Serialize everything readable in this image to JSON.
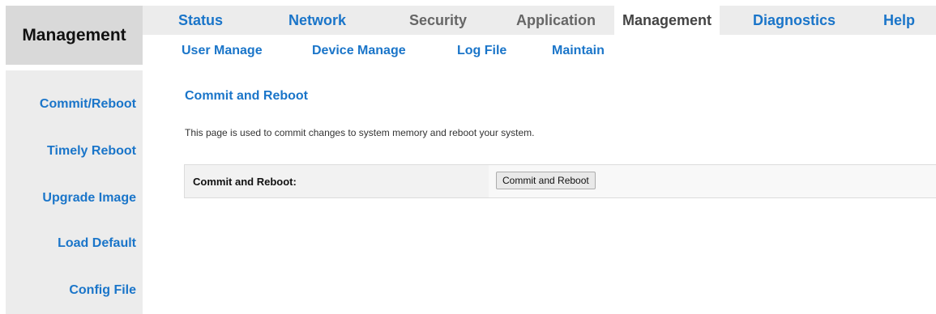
{
  "brand": {
    "title": "Management"
  },
  "top_nav": [
    {
      "label": "Status"
    },
    {
      "label": "Network"
    },
    {
      "label": "Security"
    },
    {
      "label": "Application"
    },
    {
      "label": "Management"
    },
    {
      "label": "Diagnostics"
    },
    {
      "label": "Help"
    }
  ],
  "top_nav_active": "Management",
  "sub_nav": [
    {
      "label": "User Manage"
    },
    {
      "label": "Device Manage"
    },
    {
      "label": "Log File"
    },
    {
      "label": "Maintain"
    }
  ],
  "sidebar": {
    "items": [
      {
        "label": "Commit/Reboot"
      },
      {
        "label": "Timely Reboot"
      },
      {
        "label": "Upgrade Image"
      },
      {
        "label": "Load Default"
      },
      {
        "label": "Config File"
      }
    ]
  },
  "content": {
    "title": "Commit and Reboot",
    "description": "This page is used to commit changes to system memory and reboot your system.",
    "form": {
      "label": "Commit and Reboot:",
      "button_label": "Commit and Reboot"
    }
  },
  "colors": {
    "accent": "#1a75c9",
    "panel_gray": "#ececec",
    "brand_gray": "#d9d9d9"
  }
}
